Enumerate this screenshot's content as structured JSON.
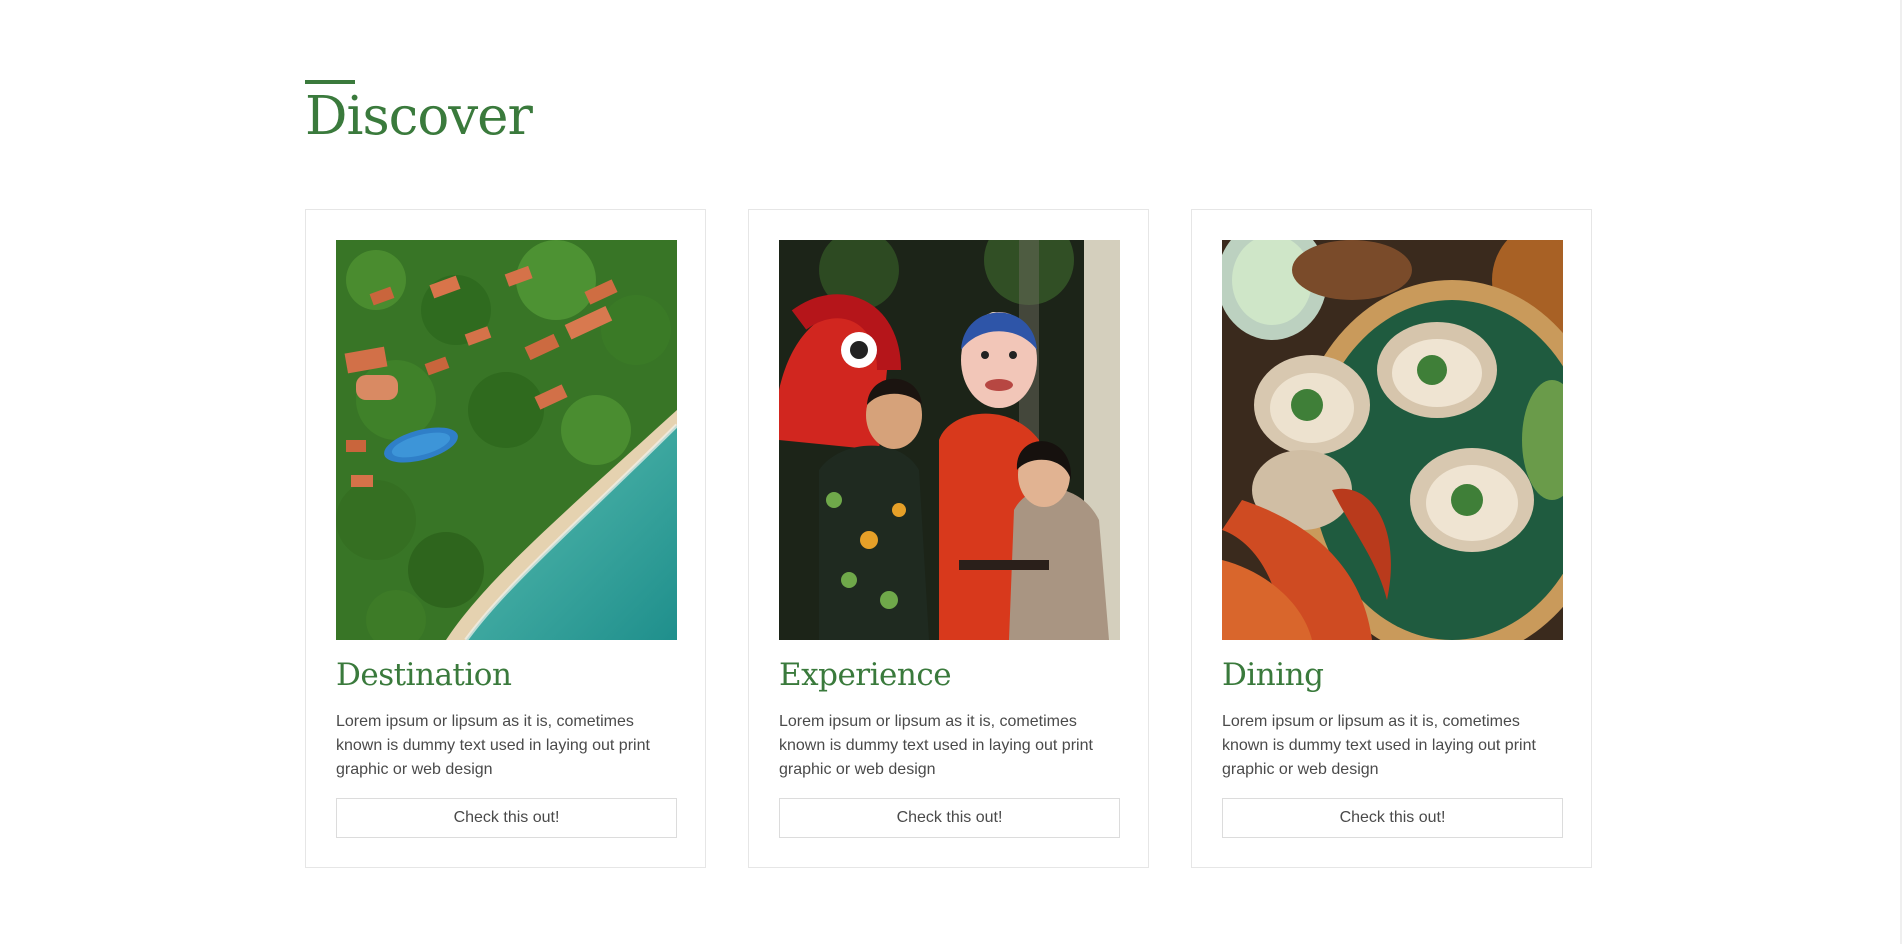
{
  "section": {
    "title": "Discover"
  },
  "cards": [
    {
      "title": "Destination",
      "description": "Lorem ipsum or lipsum as it is, cometimes known is dummy text used in laying out print graphic or web design",
      "button_label": "Check this out!",
      "image_alt": "Aerial view of resort with red-roofed villas, pool and beach"
    },
    {
      "title": "Experience",
      "description": "Lorem ipsum or lipsum as it is, cometimes known is dummy text used in laying out print graphic or web design",
      "button_label": "Check this out!",
      "image_alt": "Festive group with lion dance costume and masked performer"
    },
    {
      "title": "Dining",
      "description": "Lorem ipsum or lipsum as it is, cometimes known is dummy text used in laying out print graphic or web design",
      "button_label": "Check this out!",
      "image_alt": "Grilled scallops and prawns on a woven tray"
    }
  ],
  "colors": {
    "accent": "#3a7a3c",
    "text": "#4a4a4a",
    "border": "#e6e6e6"
  }
}
